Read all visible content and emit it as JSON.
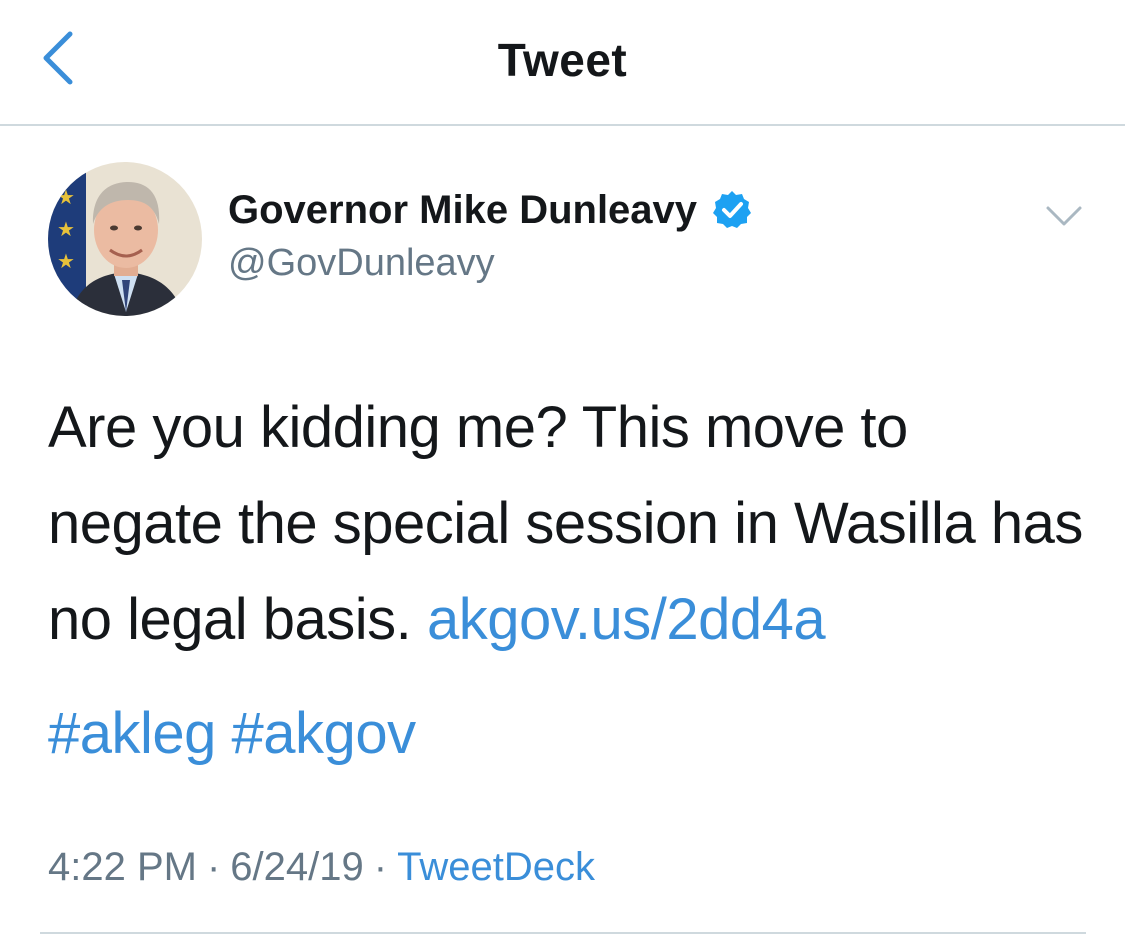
{
  "nav": {
    "title": "Tweet",
    "back_icon": "chevron-left-icon"
  },
  "tweet": {
    "author_name": "Governor Mike Dunleavy",
    "author_handle": "@GovDunleavy",
    "verified": true,
    "text": "Are you kidding me? This move to negate the special session in Wasilla has no legal basis.",
    "link": "akgov.us/2dd4a",
    "hashtags": [
      "#akleg",
      "#akgov"
    ],
    "time": "4:22 PM",
    "date": "6/24/19",
    "source": "TweetDeck",
    "separator": "·"
  },
  "colors": {
    "link": "#3a8ed9",
    "secondary_text": "#657786",
    "verified_badge": "#1da1f2",
    "divider": "#cfd9de"
  }
}
